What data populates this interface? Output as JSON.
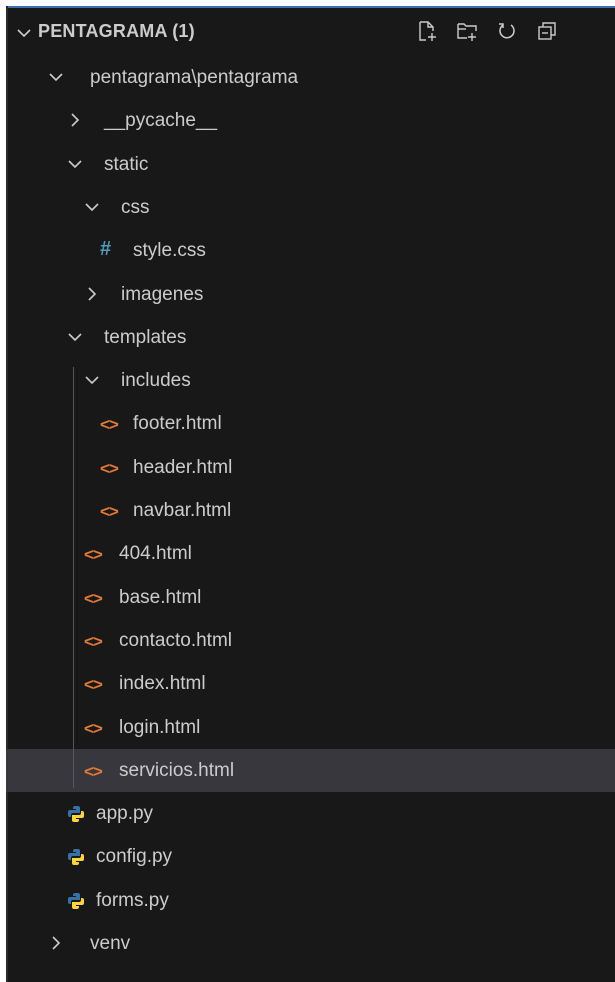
{
  "explorer": {
    "title": "PENTAGRAMA (1)",
    "actions": [
      {
        "name": "new-file",
        "icon": "new-file-icon"
      },
      {
        "name": "new-folder",
        "icon": "new-folder-icon"
      },
      {
        "name": "refresh",
        "icon": "refresh-icon"
      },
      {
        "name": "collapse-all",
        "icon": "collapse-all-icon"
      }
    ]
  },
  "tree": [
    {
      "label": "pentagrama\\pentagrama",
      "kind": "folder",
      "expanded": true,
      "depth": 1
    },
    {
      "label": "__pycache__",
      "kind": "folder",
      "expanded": false,
      "depth": 2
    },
    {
      "label": "static",
      "kind": "folder",
      "expanded": true,
      "depth": 2
    },
    {
      "label": "css",
      "kind": "folder",
      "expanded": true,
      "depth": 3
    },
    {
      "label": "style.css",
      "kind": "css",
      "depth": 4
    },
    {
      "label": "imagenes",
      "kind": "folder",
      "expanded": false,
      "depth": 3
    },
    {
      "label": "templates",
      "kind": "folder",
      "expanded": true,
      "depth": 2
    },
    {
      "label": "includes",
      "kind": "folder",
      "expanded": true,
      "depth": 3
    },
    {
      "label": "footer.html",
      "kind": "html",
      "depth": 4
    },
    {
      "label": "header.html",
      "kind": "html",
      "depth": 4
    },
    {
      "label": "navbar.html",
      "kind": "html",
      "depth": 4
    },
    {
      "label": "404.html",
      "kind": "html",
      "depth": 3
    },
    {
      "label": "base.html",
      "kind": "html",
      "depth": 3
    },
    {
      "label": "contacto.html",
      "kind": "html",
      "depth": 3
    },
    {
      "label": "index.html",
      "kind": "html",
      "depth": 3
    },
    {
      "label": "login.html",
      "kind": "html",
      "depth": 3
    },
    {
      "label": "servicios.html",
      "kind": "html",
      "depth": 3,
      "selected": true
    },
    {
      "label": "app.py",
      "kind": "py",
      "depth": 2
    },
    {
      "label": "config.py",
      "kind": "py",
      "depth": 2
    },
    {
      "label": "forms.py",
      "kind": "py",
      "depth": 2
    },
    {
      "label": "venv",
      "kind": "folder",
      "expanded": false,
      "depth": 1
    }
  ],
  "colors": {
    "background": "#181818",
    "text": "#cccccc",
    "selected_row": "#37373d",
    "html_icon": "#e37933",
    "css_icon": "#519aba",
    "python_blue": "#3572a5",
    "python_yellow": "#ffd43b",
    "indent_guide": "#585858",
    "focus_border": "#3b6fb0"
  }
}
